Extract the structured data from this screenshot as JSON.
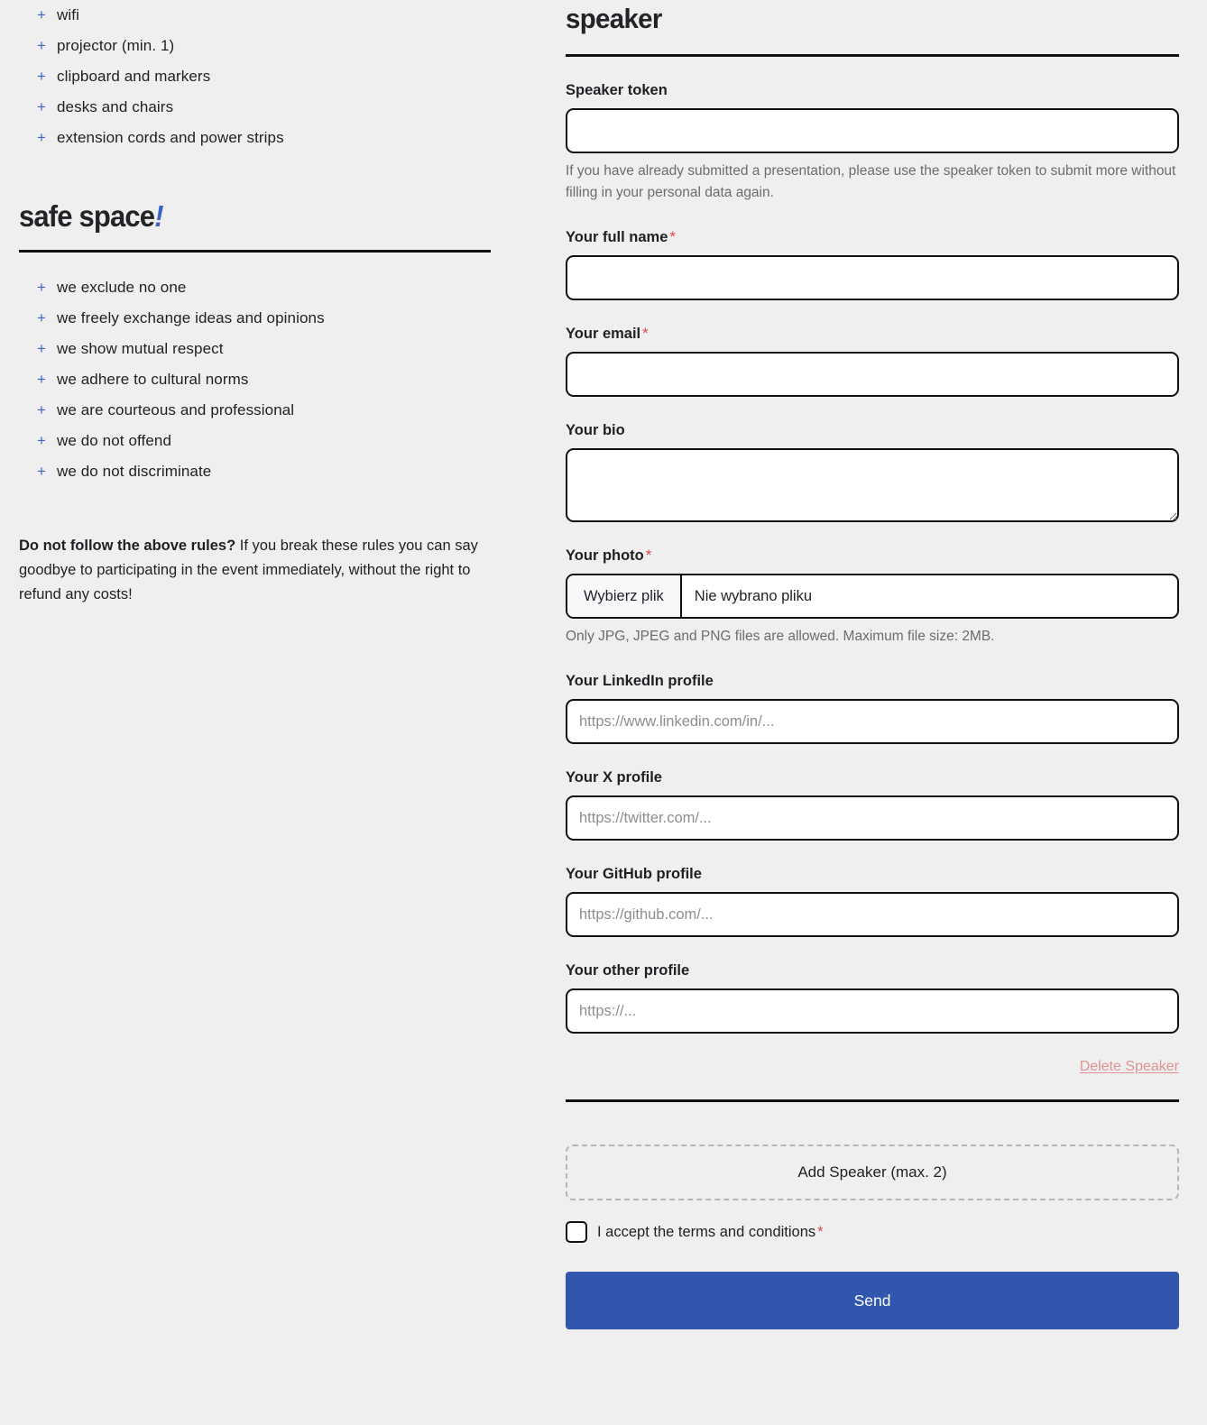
{
  "theme": {
    "background": "#efefef",
    "accent_blue": "#3a63c8",
    "button_blue": "#3057ad",
    "required_red": "#d94a4f",
    "delete_red": "#e09295",
    "text": "#1f2024",
    "muted_text": "#6c6c6c",
    "rule": "#111111"
  },
  "left": {
    "equipment_items": [
      {
        "bullet": "+",
        "label": "wifi"
      },
      {
        "bullet": "+",
        "label": "projector (min. 1)"
      },
      {
        "bullet": "+",
        "label": "clipboard and markers"
      },
      {
        "bullet": "+",
        "label": "desks and chairs"
      },
      {
        "bullet": "+",
        "label": "extension cords and power strips"
      }
    ],
    "safe_space": {
      "heading": "safe space",
      "heading_bang": "!",
      "items": [
        {
          "bullet": "+",
          "label": "we exclude no one"
        },
        {
          "bullet": "+",
          "label": "we freely exchange ideas and opinions"
        },
        {
          "bullet": "+",
          "label": "we show mutual respect"
        },
        {
          "bullet": "+",
          "label": "we adhere to cultural norms"
        },
        {
          "bullet": "+",
          "label": "we are courteous and professional"
        },
        {
          "bullet": "+",
          "label": "we do not offend"
        },
        {
          "bullet": "+",
          "label": "we do not discriminate"
        }
      ],
      "note_bold": "Do not follow the above rules?",
      "note_rest": " If you break these rules you can say goodbye to participating in the event immediately, without the right to refund any costs!"
    }
  },
  "form": {
    "heading": "speaker",
    "fields": {
      "speaker_token": {
        "label": "Speaker token",
        "value": "",
        "placeholder": "",
        "help": "If you have already submitted a presentation, please use the speaker token to submit more without filling in your personal data again."
      },
      "full_name": {
        "label": "Your full name",
        "required_mark": "*",
        "value": "",
        "placeholder": ""
      },
      "email": {
        "label": "Your email",
        "required_mark": "*",
        "value": "",
        "placeholder": ""
      },
      "bio": {
        "label": "Your bio",
        "value": "",
        "placeholder": ""
      },
      "photo": {
        "label": "Your photo",
        "required_mark": "*",
        "choose_button": "Wybierz plik",
        "file_status": "Nie wybrano pliku",
        "help": "Only JPG, JPEG and PNG files are allowed. Maximum file size: 2MB."
      },
      "linkedin": {
        "label": "Your LinkedIn profile",
        "value": "",
        "placeholder": "https://www.linkedin.com/in/..."
      },
      "x_profile": {
        "label": "Your X profile",
        "value": "",
        "placeholder": "https://twitter.com/..."
      },
      "github": {
        "label": "Your GitHub profile",
        "value": "",
        "placeholder": "https://github.com/..."
      },
      "other": {
        "label": "Your other profile",
        "value": "",
        "placeholder": "https://..."
      }
    },
    "delete_speaker": "Delete Speaker",
    "add_speaker": "Add Speaker (max. 2)",
    "terms_label": "I accept the terms and conditions",
    "terms_required_mark": "*",
    "submit": "Send"
  }
}
